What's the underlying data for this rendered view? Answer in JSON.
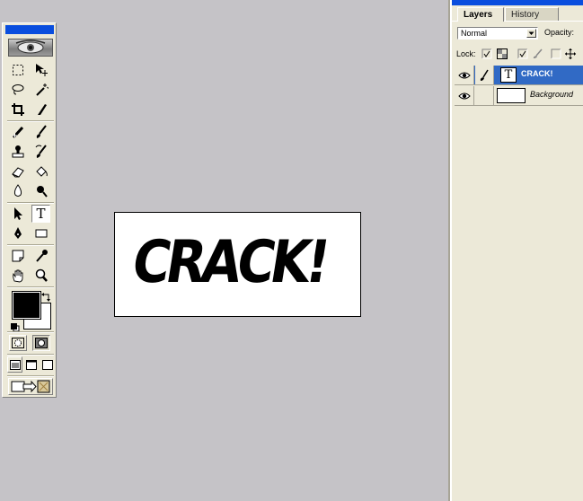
{
  "document": {
    "canvas_text": "CRACK!"
  },
  "toolbox": {
    "tools": [
      {
        "name": "rectangular-marquee",
        "icon": "marquee-icon"
      },
      {
        "name": "move",
        "icon": "move-icon"
      },
      {
        "name": "lasso",
        "icon": "lasso-icon"
      },
      {
        "name": "magic-wand",
        "icon": "magic-wand-icon"
      },
      {
        "name": "crop",
        "icon": "crop-icon"
      },
      {
        "name": "slice",
        "icon": "slice-icon"
      },
      {
        "name": "healing-brush",
        "icon": "healing-brush-icon"
      },
      {
        "name": "brush",
        "icon": "brush-icon"
      },
      {
        "name": "clone-stamp",
        "icon": "stamp-icon"
      },
      {
        "name": "history-brush",
        "icon": "history-brush-icon"
      },
      {
        "name": "eraser",
        "icon": "eraser-icon"
      },
      {
        "name": "paint-bucket",
        "icon": "bucket-icon"
      },
      {
        "name": "blur",
        "icon": "blur-icon"
      },
      {
        "name": "dodge",
        "icon": "dodge-icon"
      },
      {
        "name": "path-selection",
        "icon": "path-select-icon"
      },
      {
        "name": "type",
        "icon": "type-icon",
        "label": "T"
      },
      {
        "name": "pen",
        "icon": "pen-icon"
      },
      {
        "name": "rectangle-shape",
        "icon": "rectangle-icon"
      },
      {
        "name": "notes",
        "icon": "notes-icon"
      },
      {
        "name": "eyedropper",
        "icon": "eyedropper-icon"
      },
      {
        "name": "hand",
        "icon": "hand-icon"
      },
      {
        "name": "zoom",
        "icon": "zoom-icon"
      }
    ],
    "foreground_color": "#000000",
    "background_color": "#ffffff"
  },
  "layers_panel": {
    "tabs": [
      {
        "label": "Layers",
        "active": true
      },
      {
        "label": "History",
        "active": false
      }
    ],
    "blend_mode": "Normal",
    "opacity_label": "Opacity:",
    "lock_label": "Lock:",
    "layers": [
      {
        "name": "CRACK!",
        "type": "text",
        "thumb": "T",
        "visible": true,
        "selected": true
      },
      {
        "name": "Background",
        "type": "raster",
        "visible": true,
        "selected": false
      }
    ]
  },
  "colors": {
    "workspace": "#c5c3c7",
    "panel": "#ece9d8",
    "titlebar": "#0a4ede",
    "selection": "#316ac5"
  }
}
